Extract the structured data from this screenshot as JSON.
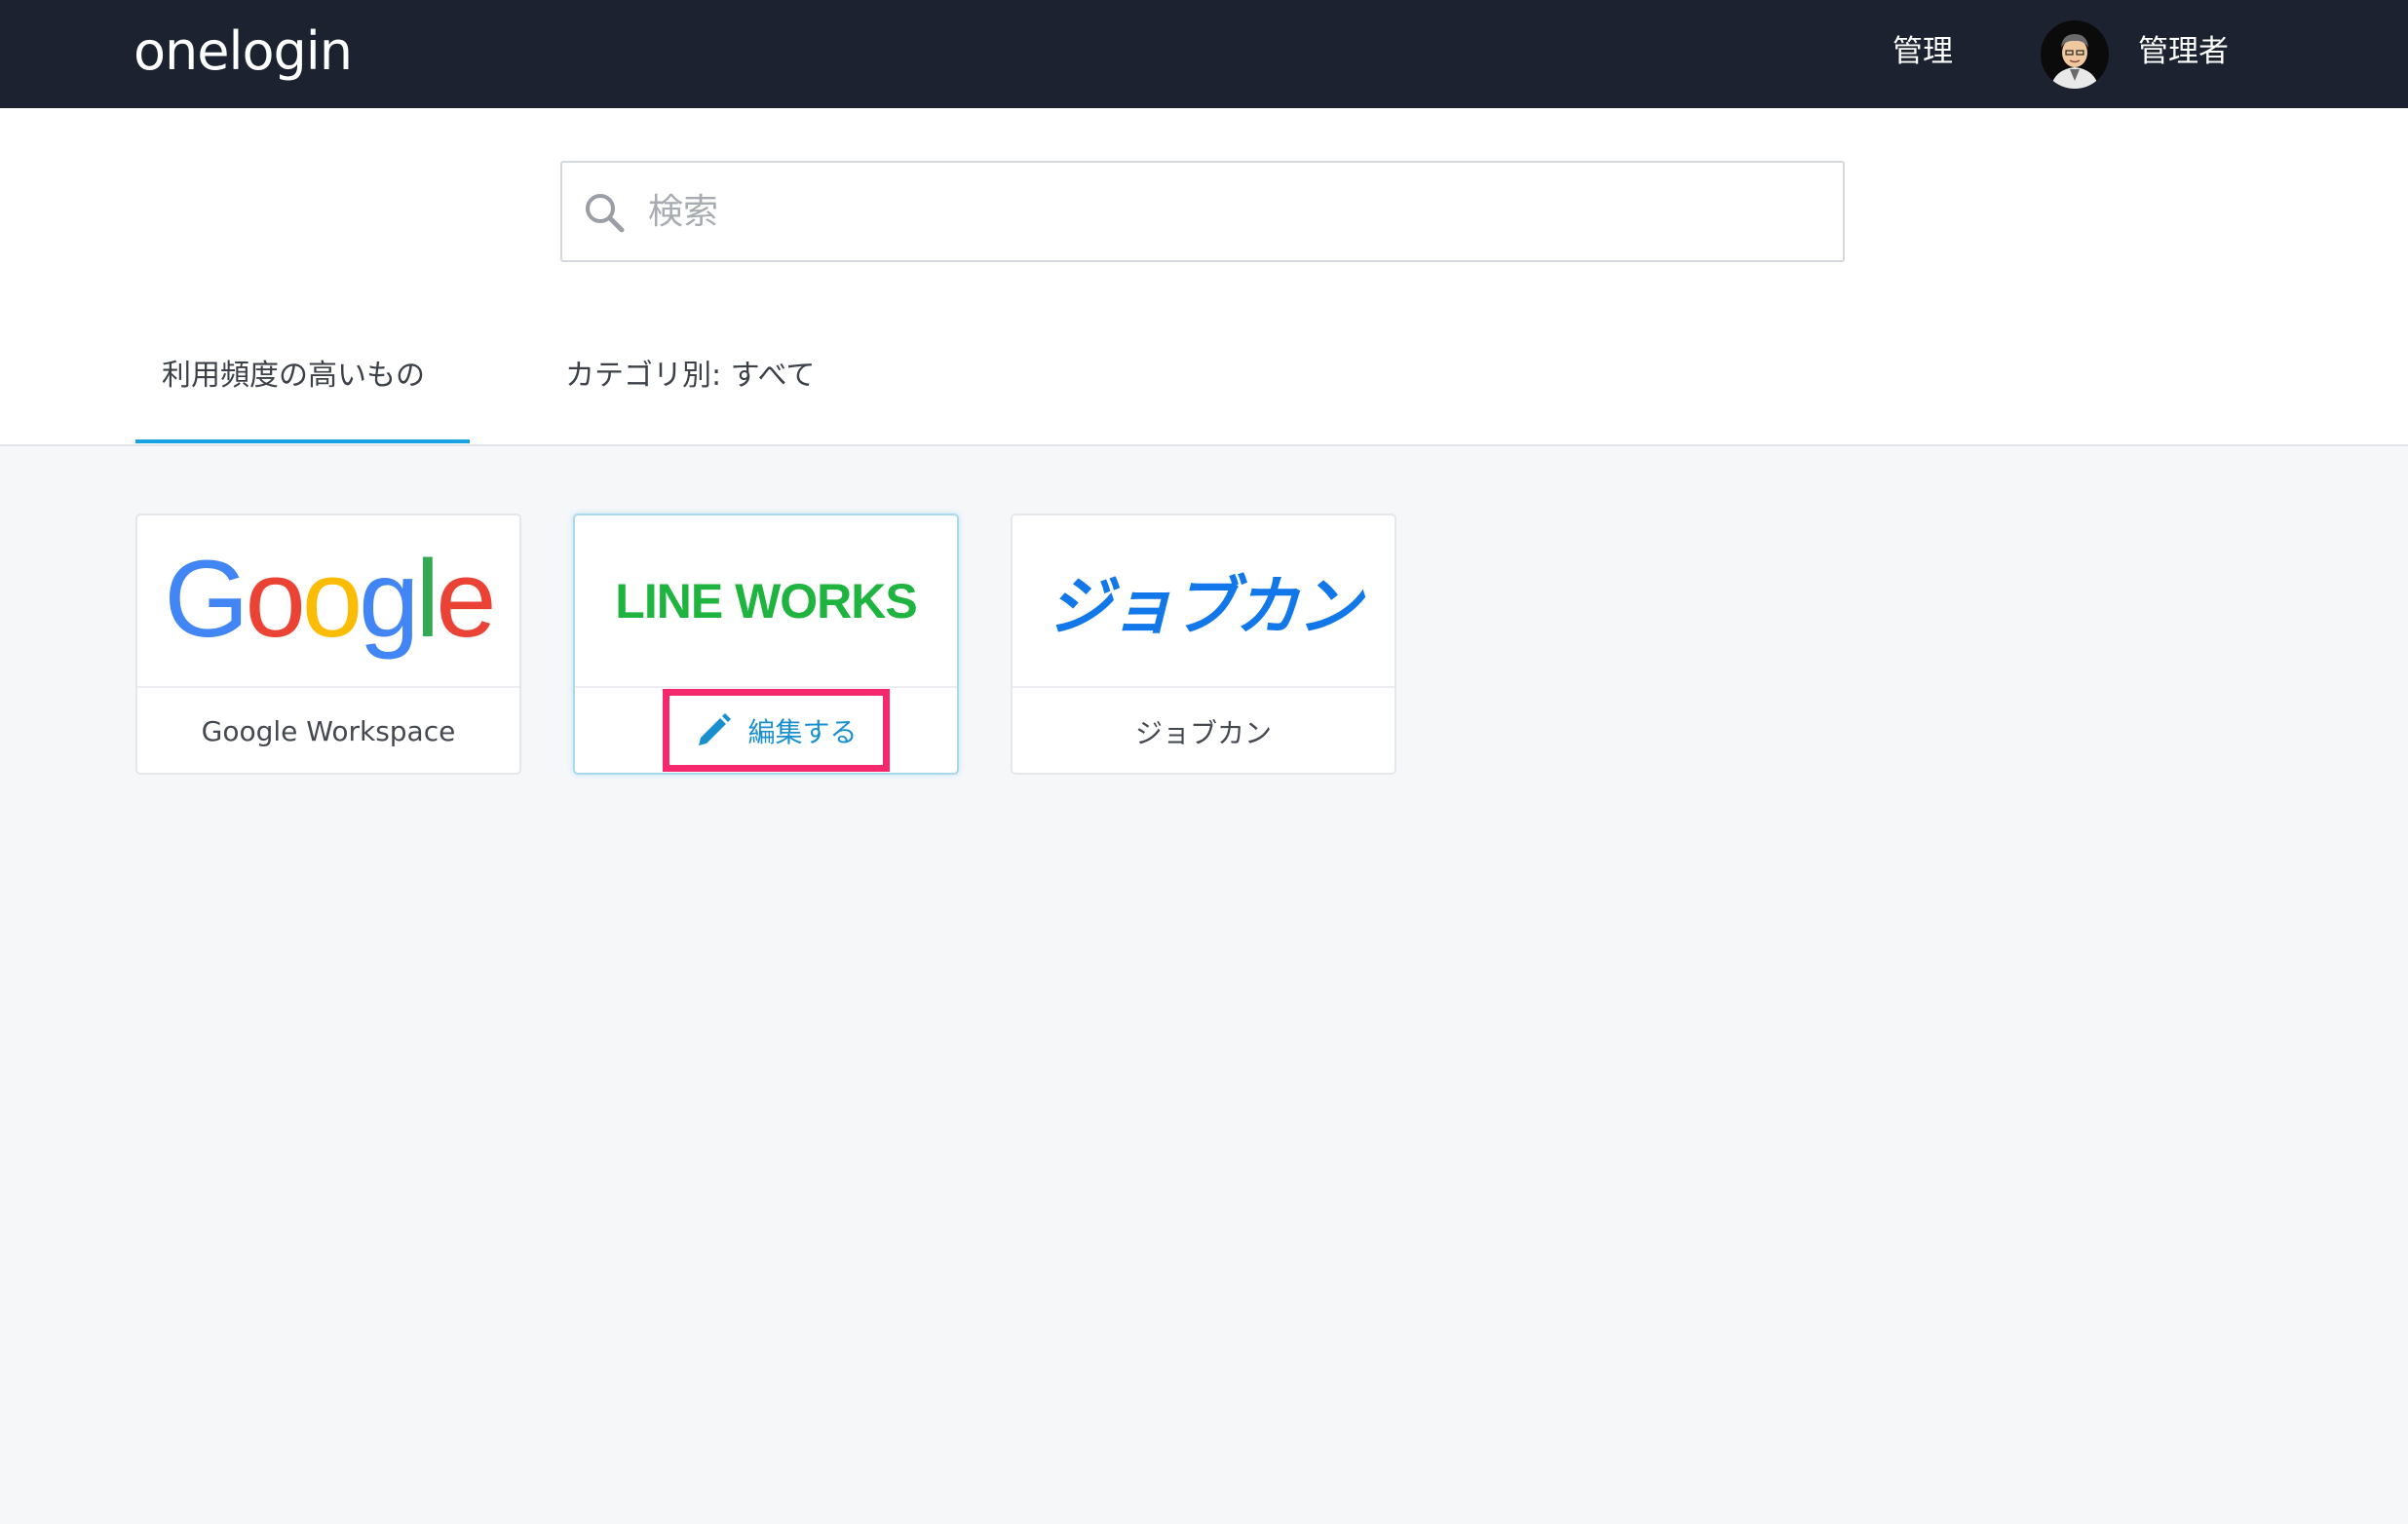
{
  "header": {
    "brand": "onelogin",
    "admin_link": "管理",
    "user_name": "管理者"
  },
  "search": {
    "placeholder": "検索",
    "value": ""
  },
  "tabs": [
    {
      "label": "利用頻度の高いもの",
      "active": true
    },
    {
      "label": "カテゴリ別: すべて",
      "active": false
    }
  ],
  "apps": [
    {
      "logo_text": "Google",
      "label": "Google Workspace"
    },
    {
      "logo_text": "LINE WORKS",
      "edit_label": "編集する"
    },
    {
      "logo_text": "ジョブカン",
      "label": "ジョブカン"
    }
  ],
  "colors": {
    "header_bg": "#1c2230",
    "tab_active_underline": "#1aa1e4",
    "edit_highlight": "#f5286e",
    "edit_text": "#1a8fd0",
    "lineworks_green": "#1fb33f",
    "jobcan_blue": "#1277e8"
  },
  "icons": [
    "search-icon",
    "pencil-icon",
    "user-avatar"
  ]
}
